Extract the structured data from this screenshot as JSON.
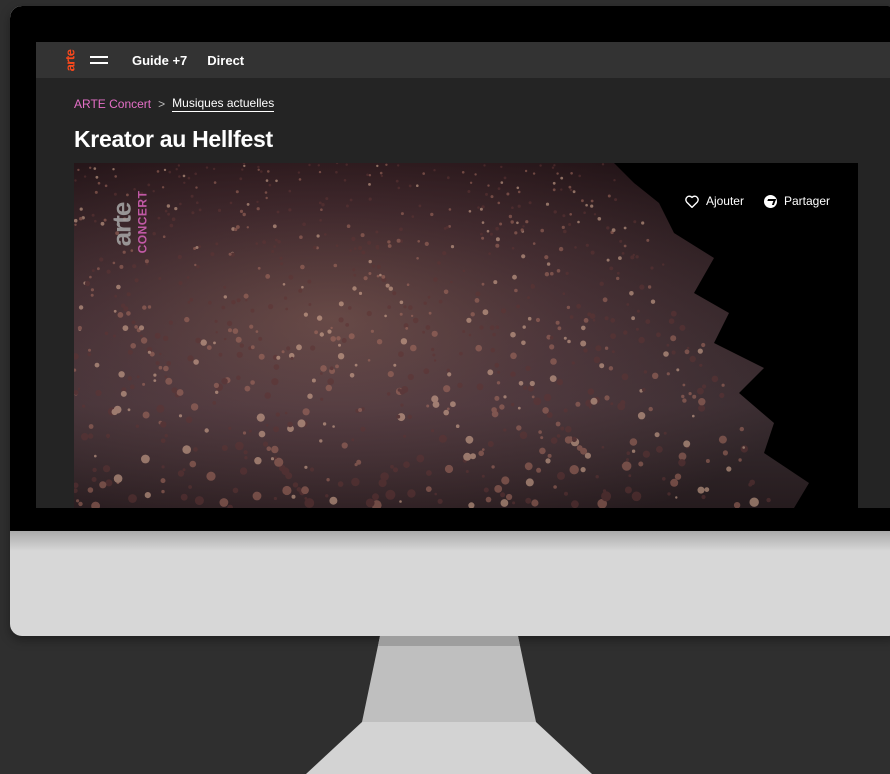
{
  "nav": {
    "logo": "arte",
    "links": [
      "Guide +7",
      "Direct"
    ]
  },
  "breadcrumb": {
    "home": "ARTE Concert",
    "separator": ">",
    "current": "Musiques actuelles"
  },
  "page": {
    "title": "Kreator au Hellfest"
  },
  "video": {
    "watermark_brand": "arte",
    "watermark_sub": "CONCERT",
    "actions": {
      "add": "Ajouter",
      "share": "Partager"
    }
  },
  "colors": {
    "accent_logo": "#fa481c",
    "breadcrumb_pink": "#e56fc7",
    "nav_bg": "#333333",
    "page_bg": "#242424"
  }
}
